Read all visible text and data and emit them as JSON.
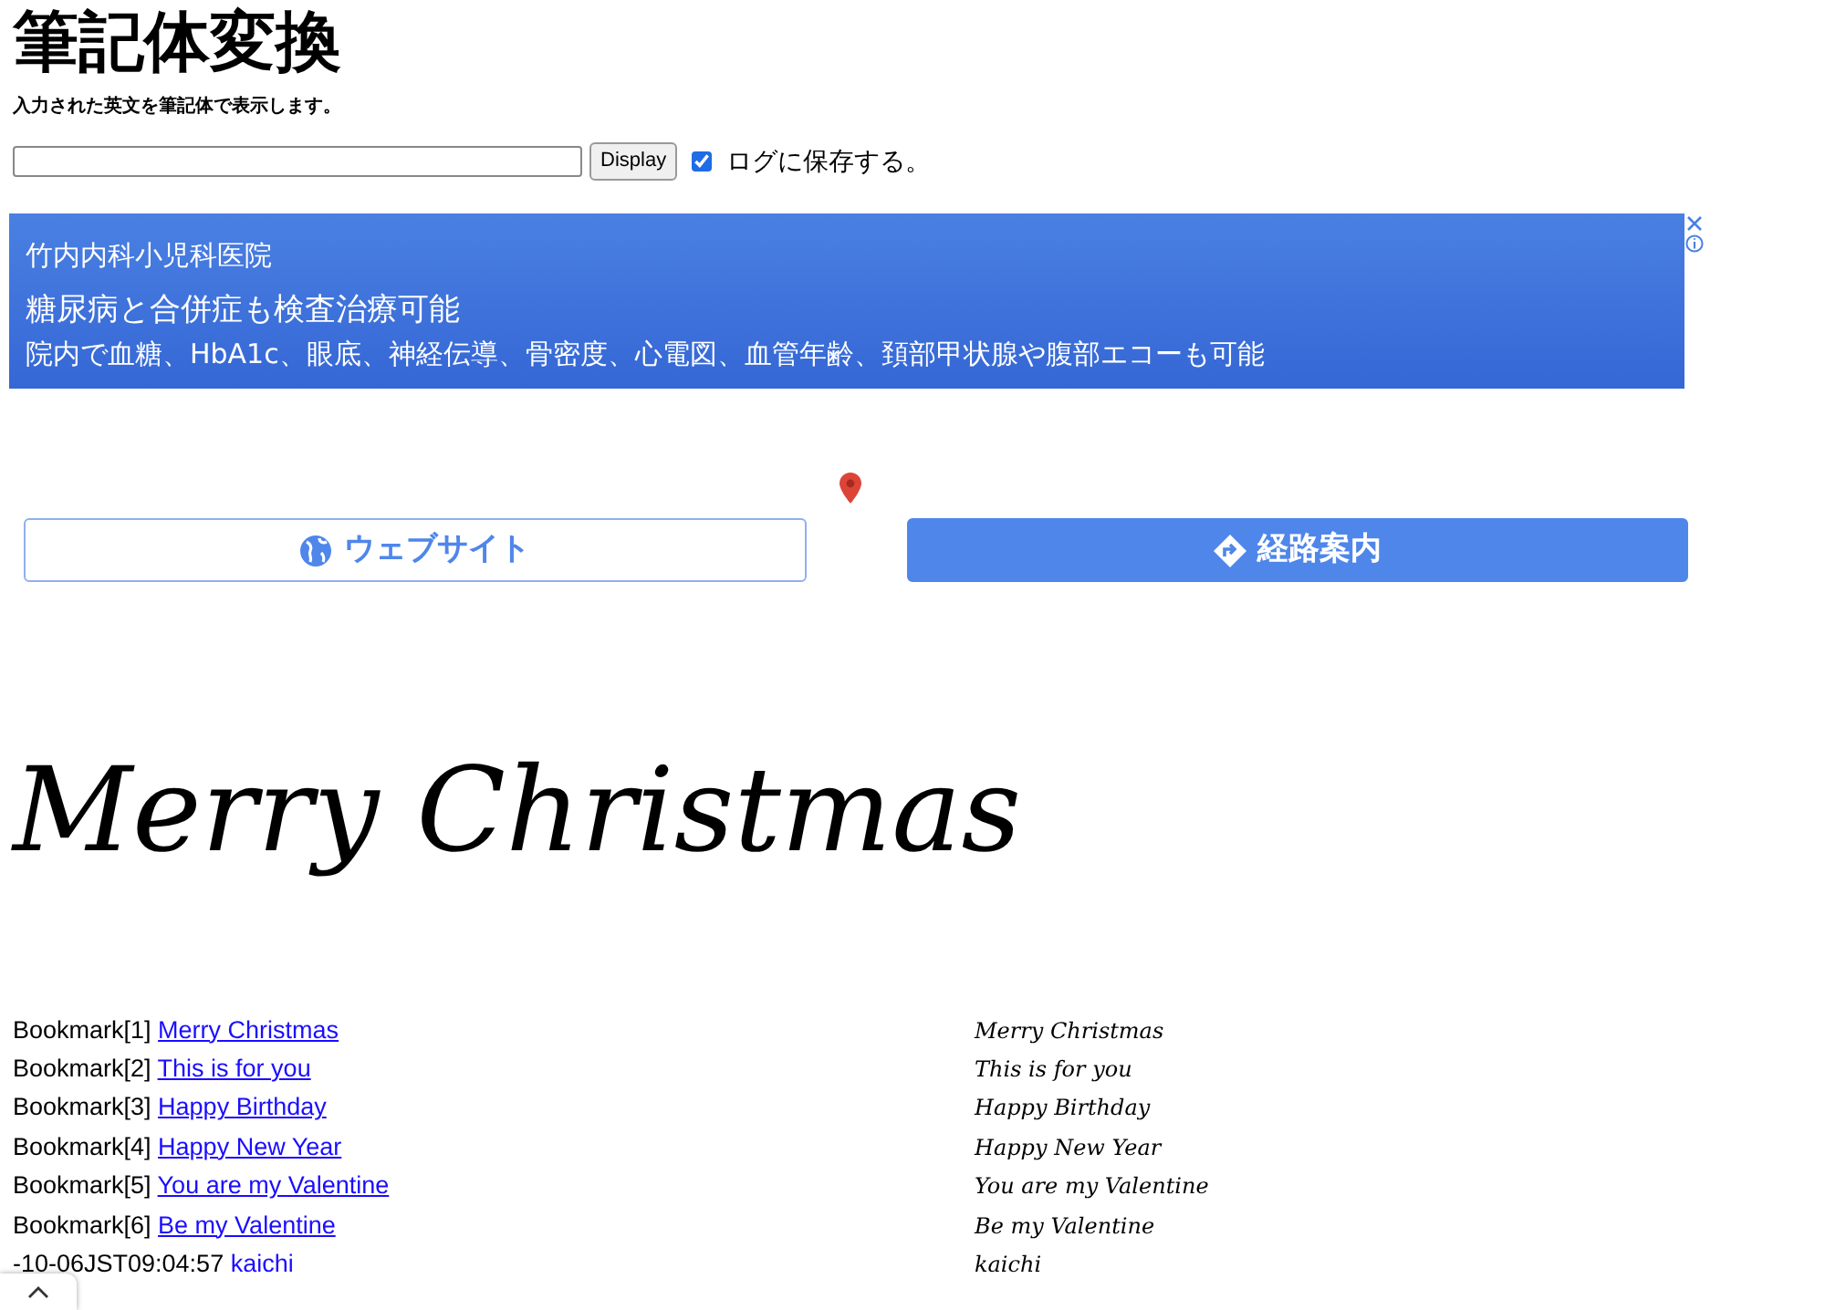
{
  "title": "筆記体変換",
  "subtitle": "入力された英文を筆記体で表示します。",
  "form": {
    "button": "Display",
    "save_log": {
      "label": "ログに保存する。",
      "checked": true
    }
  },
  "ad": {
    "advertiser": "竹内内科小児科医院",
    "headline": "糖尿病と合併症も検査治療可能",
    "body": "院内で血糖、HbA1c、眼底、神経伝導、骨密度、心電図、血管年齢、頚部甲状腺や腹部エコーも可能"
  },
  "ad_buttons": [
    {
      "kind": "website",
      "label": "ウェブサイト"
    },
    {
      "kind": "directions",
      "label": "経路案内"
    }
  ],
  "preview": "Merry Christmas",
  "bookmarks": [
    {
      "label": "Bookmark[1]",
      "link": "Merry Christmas",
      "script": "Merry Christmas"
    },
    {
      "label": "Bookmark[2]",
      "link": "This is for you",
      "script": "This is for you"
    },
    {
      "label": "Bookmark[3]",
      "link": "Happy Birthday",
      "script": "Happy Birthday"
    },
    {
      "label": "Bookmark[4]",
      "link": "Happy New Year",
      "script": "Happy New Year"
    },
    {
      "label": "Bookmark[5]",
      "link": "You are my Valentine",
      "script": "You are my Valentine"
    },
    {
      "label": "Bookmark[6]",
      "link": "Be my Valentine",
      "script": "Be my Valentine"
    }
  ],
  "log_entry": {
    "timestamp": "-10-06JST09:04:57",
    "author": "kaichi",
    "script": "kaichi"
  }
}
